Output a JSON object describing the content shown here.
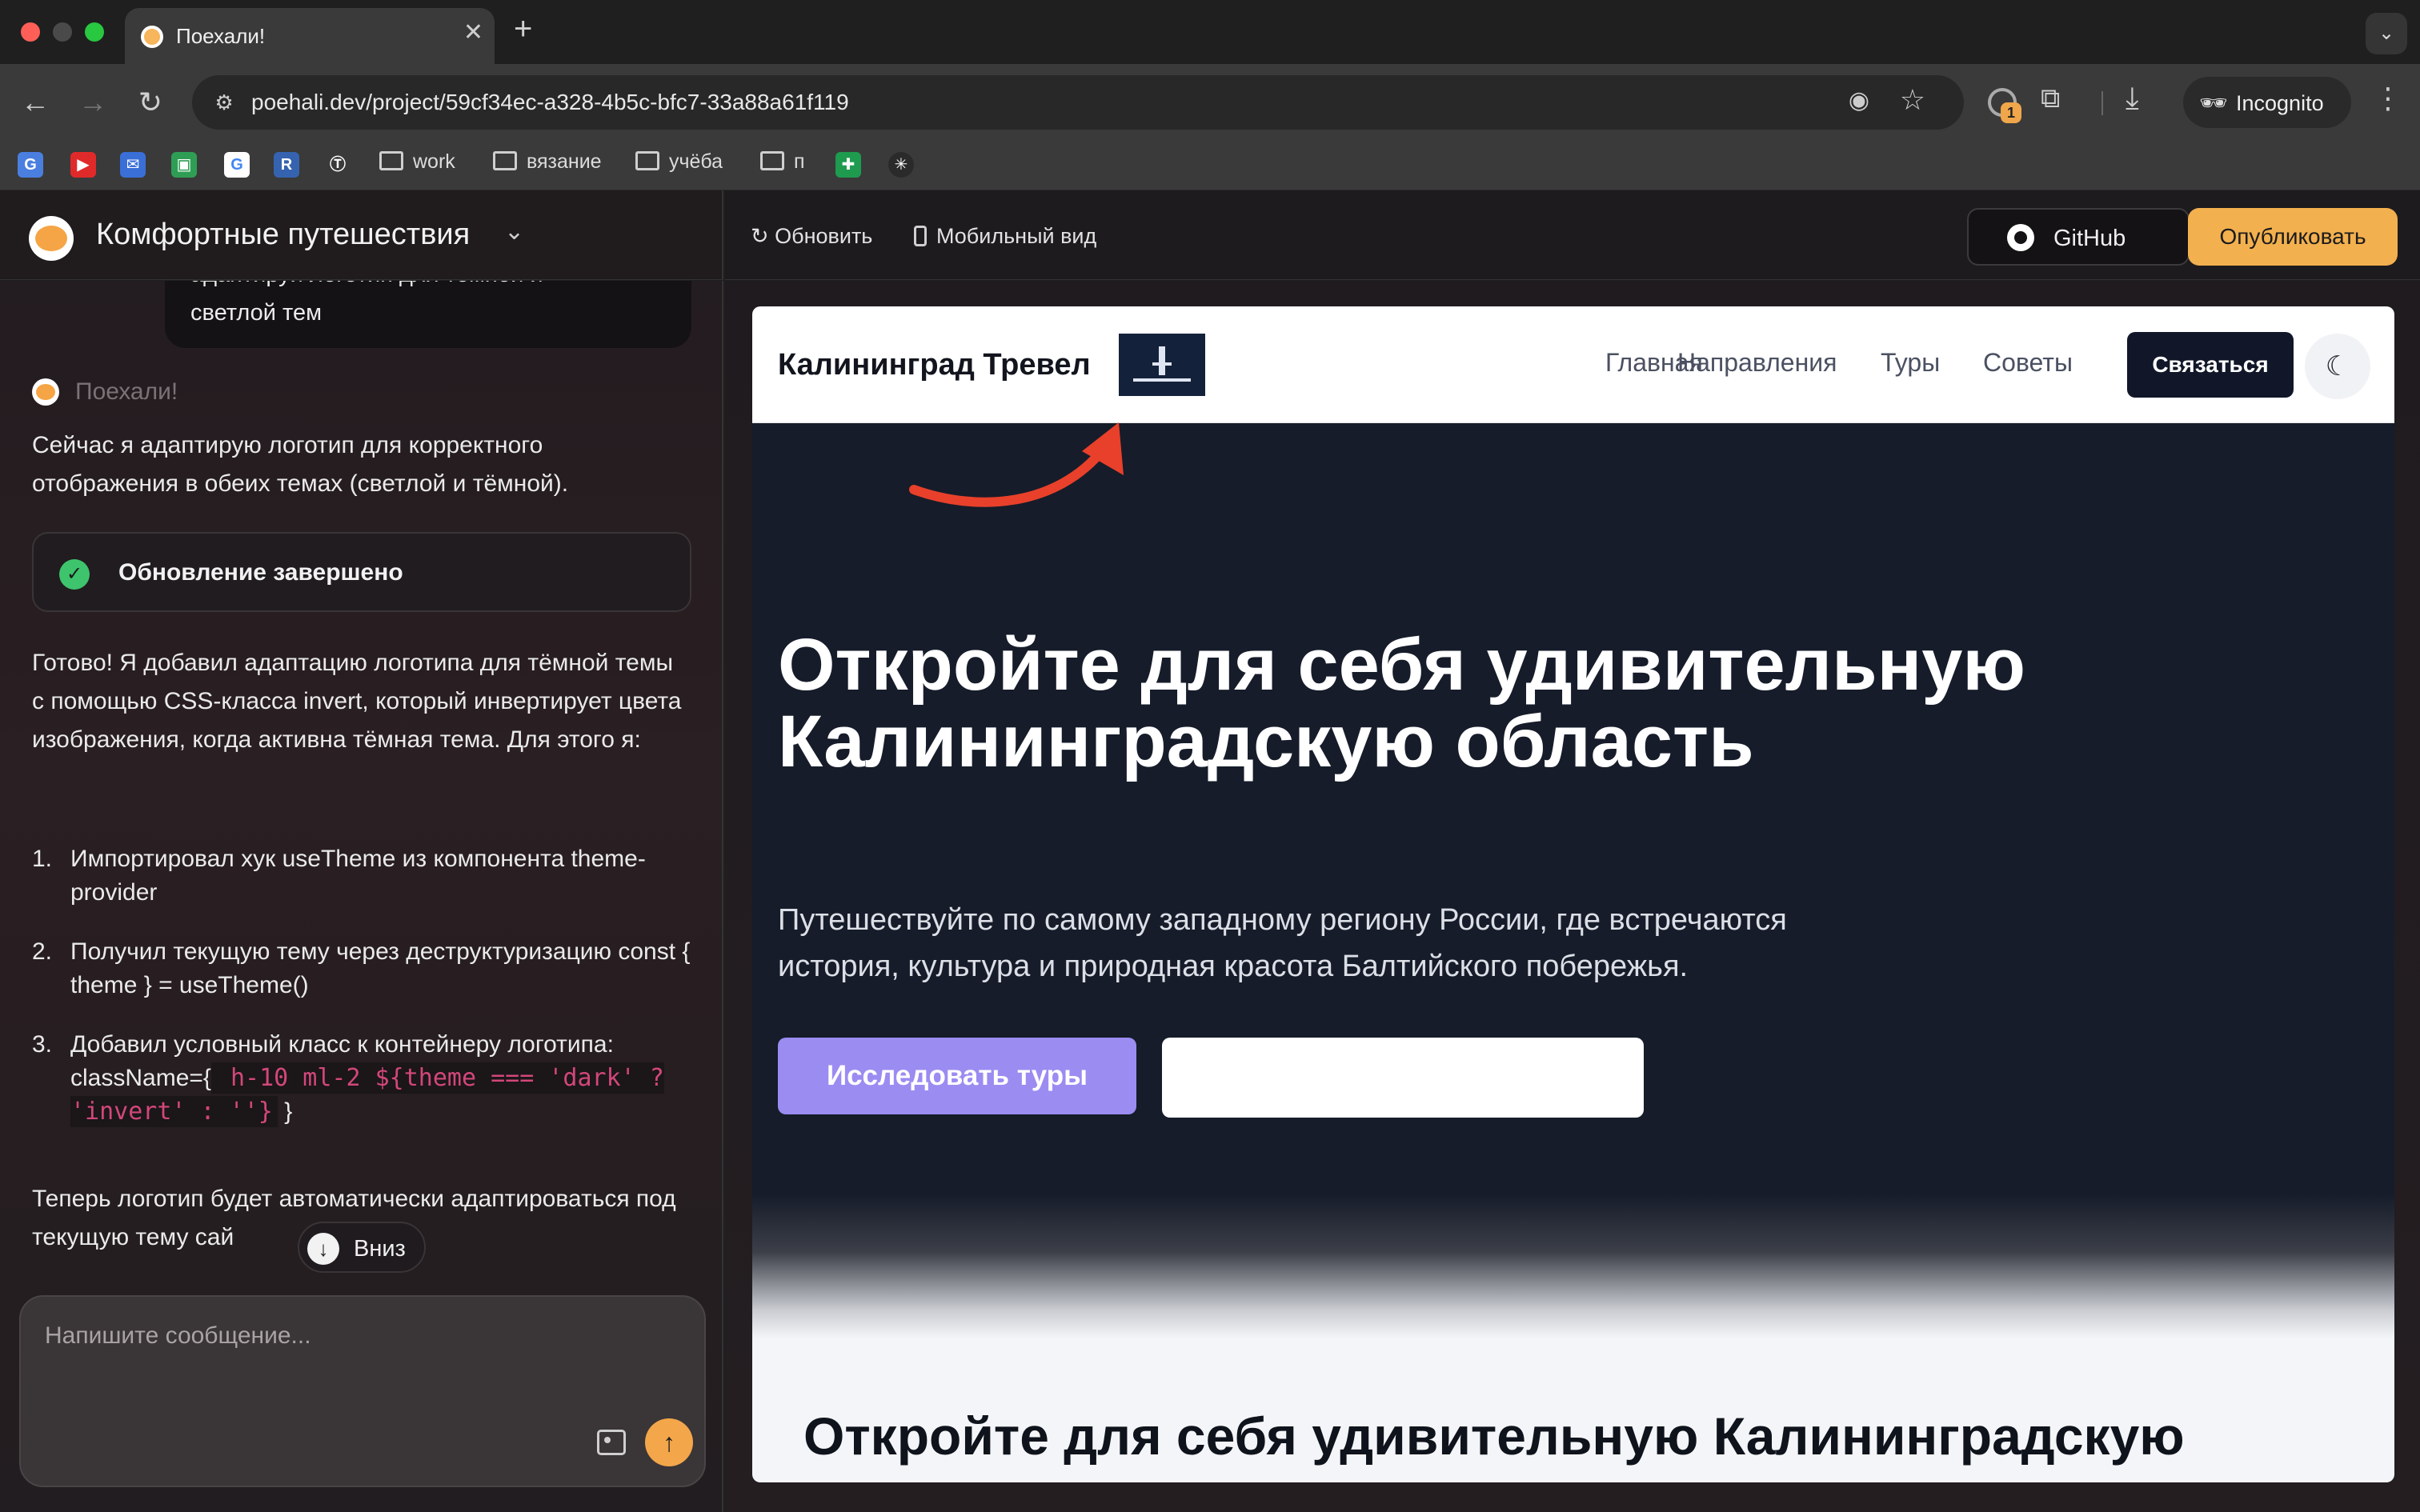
{
  "browser": {
    "tab_title": "Поехали!",
    "url": "poehali.dev/project/59cf34ec-a328-4b5c-bfc7-33a88a61f119",
    "profile_label": "Incognito",
    "extension_badge": "1",
    "bookmarks": {
      "icons": [
        {
          "name": "google-translate-icon",
          "glyph": "G",
          "color": "#4a7fe0"
        },
        {
          "name": "youtube-icon",
          "glyph": "▶",
          "color": "#e02a2a"
        },
        {
          "name": "mail-icon",
          "glyph": "✉",
          "color": "#3a6fd8"
        },
        {
          "name": "meet-icon",
          "glyph": "▣",
          "color": "#2f9e55"
        },
        {
          "name": "google-icon",
          "glyph": "G",
          "color": "#ffffff"
        },
        {
          "name": "r-icon",
          "glyph": "R",
          "color": "#3563b0"
        },
        {
          "name": "t-icon",
          "glyph": "Ⓣ",
          "color": "#3a3a3a"
        }
      ],
      "folders": [
        "work",
        "вязание",
        "учёба",
        "п"
      ],
      "extra_icons": [
        {
          "name": "sheets-icon",
          "glyph": "✚",
          "color": "#1e9b4f"
        },
        {
          "name": "perplexity-icon",
          "glyph": "✳",
          "color": "#2a2a2a"
        }
      ]
    }
  },
  "app": {
    "project_name": "Комфортные путешествия",
    "refresh_label": "Обновить",
    "mobile_label": "Мобильный вид",
    "github_label": "GitHub",
    "publish_label": "Опубликовать"
  },
  "chat": {
    "user_message_cut": "адаптируй логотип для тёмной и",
    "user_message_tail": "светлой тем",
    "assistant_name": "Поехали!",
    "intro": "Сейчас я адаптирую логотип для корректного отображения в обеих темах (светлой и тёмной).",
    "status": "Обновление завершено",
    "summary": "Готово! Я добавил адаптацию логотипа для тёмной темы с помощью CSS-класса invert, который инвертирует цвета изображения, когда активна тёмная тема. Для этого я:",
    "steps": [
      {
        "num": "1.",
        "text": "Импортировал хук useTheme из компонента theme-provider"
      },
      {
        "num": "2.",
        "text": "Получил текущую тему через деструктуризацию const { theme } = useTheme()"
      },
      {
        "num": "3.",
        "text_prefix": "Добавил условный класс к контейнеру логотипа: className={",
        "code": " h-10 ml-2 ${theme === 'dark' ? 'invert' : ''}",
        "text_suffix": " }"
      }
    ],
    "closing": "Теперь логотип будет автоматически адаптироваться под текущую тему сай",
    "scroll_down_label": "Вниз",
    "composer_placeholder": "Напишите сообщение..."
  },
  "site": {
    "brand": "Калининград Тревел",
    "nav": [
      "Главная",
      "Направления",
      "Туры",
      "Советы"
    ],
    "contact_label": "Связаться",
    "hero_title": "Откройте для себя удивительную Калининградскую область",
    "hero_subtitle": "Путешествуйте по самому западному региону России, где встречаются история, культура и природная красота Балтийского побережья.",
    "explore_label": "Исследовать туры",
    "section_title": "Откройте для себя удивительную Калининградскую"
  },
  "colors": {
    "accent": "#f3b04e",
    "annotation_arrow": "#e8402a",
    "explore_button": "#9b8cf2",
    "hero_bg": "#161c2a"
  }
}
